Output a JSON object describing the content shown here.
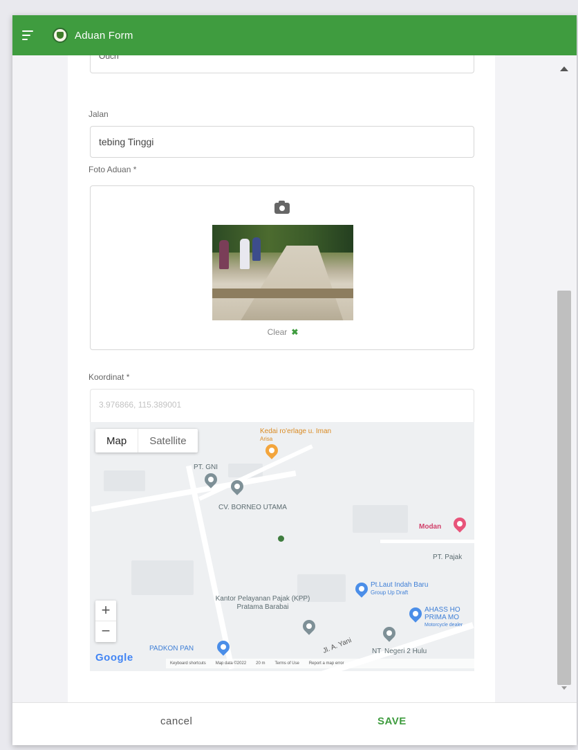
{
  "app": {
    "title": "Aduan Form",
    "menu_icon": "menu-icon",
    "logo_icon": "logo-icon"
  },
  "form": {
    "top_field_partial": "Ouch",
    "jalan": {
      "label": "Jalan",
      "value": "tebing Tinggi"
    },
    "foto": {
      "label": "Foto Aduan *",
      "camera_icon": "camera-icon",
      "clear_label": "Clear",
      "clear_icon": "✖"
    },
    "koordinat": {
      "label": "Koordinat *",
      "value": "3.976866, 115.389001"
    }
  },
  "map": {
    "map_label": "Map",
    "satellite_label": "Satellite",
    "zoom_in": "+",
    "zoom_out": "−",
    "google": "Google",
    "attribution": [
      "Keyboard shortcuts",
      "Map data ©2022",
      "20 m",
      "Terms of Use",
      "Report a map error"
    ],
    "places": {
      "kedai": "Kedai ro'erlage u. Iman",
      "kedai_sub": "Arisa",
      "ptgni": "PT. GNI",
      "cvborneo": "CV. BORNEO UTAMA",
      "modan": "Modan",
      "ptpajak": "PT. Pajak",
      "ptlaut": "Pt.Laut Indah Baru",
      "ptlaut_sub": "Group Up Draft",
      "kantor": "Kantor Pelayanan Pajak (KPP) Pratama Barabai",
      "ahass": "AHASS HO PRIMA MO",
      "ahass_sub": "Motorcycle dealer",
      "padkon": "PADKON PAN",
      "jl": "Jl. A. Yani",
      "nt": "NT",
      "nt2": "Negeri 2 Hulu"
    }
  },
  "footer": {
    "cancel": "cancel",
    "save": "SAVE"
  },
  "colors": {
    "accent": "#3f9c3f"
  }
}
